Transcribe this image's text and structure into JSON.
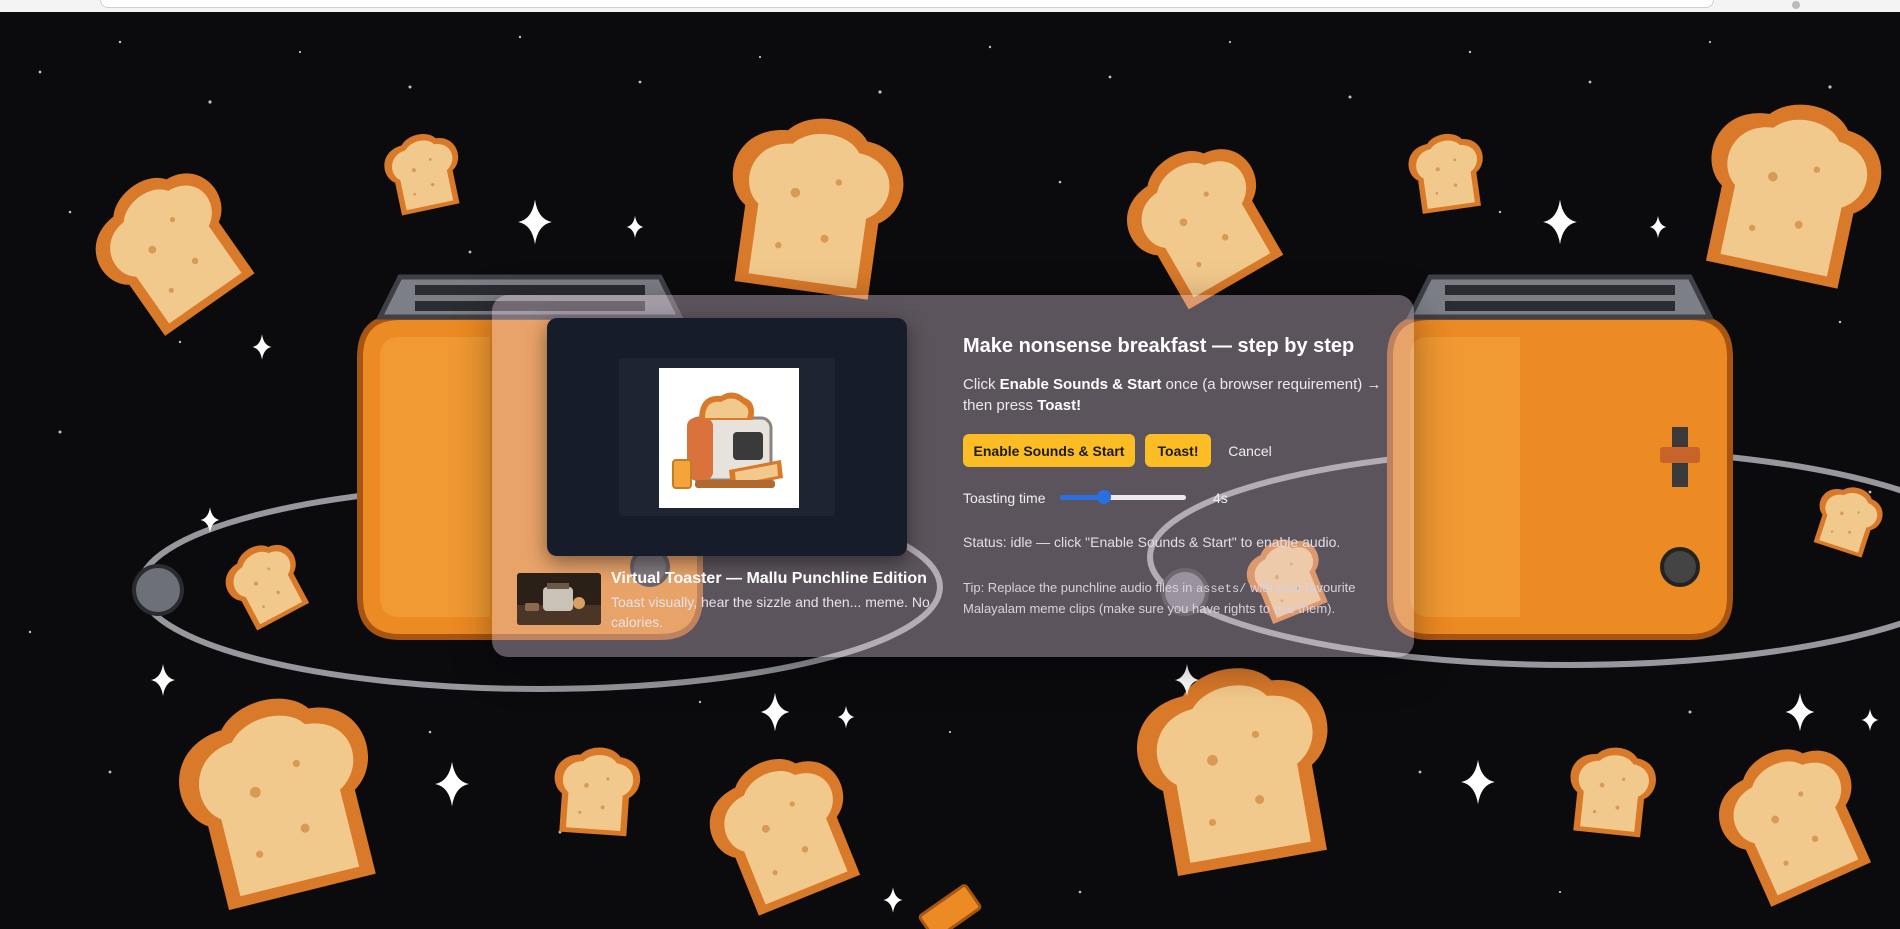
{
  "app": {
    "heading": "Make nonsense breakfast — step by step",
    "instructions": {
      "prefix": "Click ",
      "enable_bold": "Enable Sounds & Start",
      "middle": " once (a browser requirement) → then press ",
      "toast_bold": "Toast!"
    },
    "buttons": {
      "enable_start": "Enable Sounds & Start",
      "toast": "Toast!",
      "cancel": "Cancel"
    },
    "toasting": {
      "label": "Toasting time",
      "value": 4,
      "display": "4s",
      "fill_fraction": 0.35
    },
    "status_text": "Status: idle — click \"Enable Sounds & Start\" to enable audio.",
    "tip": {
      "prefix": "Tip: Replace the punchline audio files in ",
      "code": "assets/",
      "suffix": " with your favourite Malayalam meme clips (make sure you have rights to use them)."
    }
  },
  "video": {
    "title": "Virtual Toaster — Mallu Punchline Edition",
    "description": "Toast visually, hear the sizzle and then... meme. No calories."
  },
  "colors": {
    "accent_button": "#fbbd23",
    "slider_fill": "#2a6fe0",
    "toaster_orange": "#ec8a23",
    "bread_crust": "#d9792a",
    "bread_crumb": "#f2c98c",
    "space_bg": "#0b0b0d"
  }
}
